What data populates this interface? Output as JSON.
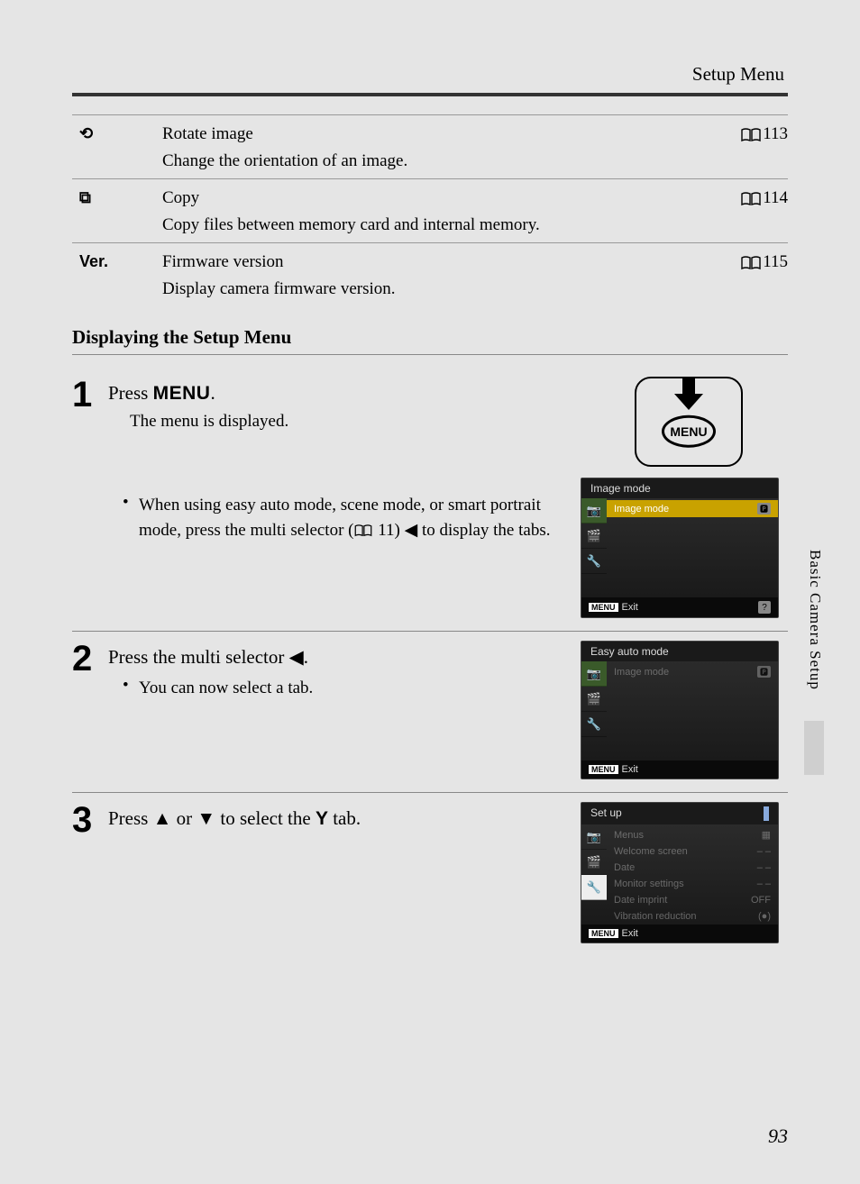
{
  "header": {
    "section": "Setup Menu"
  },
  "table": {
    "rows": [
      {
        "icon": "rotate",
        "title": "Rotate image",
        "ref": "113",
        "desc": "Change the orientation of an image."
      },
      {
        "icon": "copy",
        "title": "Copy",
        "ref": "114",
        "desc": "Copy files between memory card and internal memory."
      },
      {
        "icon": "ver",
        "icon_label": "Ver.",
        "title": "Firmware version",
        "ref": "115",
        "desc": "Display camera firmware version."
      }
    ]
  },
  "heading": "Displaying the Setup Menu",
  "steps": {
    "s1": {
      "num": "1",
      "title_pre": "Press ",
      "title_btn": "MENU",
      "title_post": ".",
      "note": "The menu is displayed.",
      "bullet_pre": "When using easy auto mode, scene mode, or smart portrait mode, press the multi selector (",
      "bullet_ref": "11",
      "bullet_post": ") ◀ to display the tabs.",
      "menu_label": "MENU",
      "lcd": {
        "title": "Image mode",
        "row_label": "Image mode",
        "exit": "Exit"
      }
    },
    "s2": {
      "num": "2",
      "title": "Press the multi selector ◀.",
      "bullet": "You can now select a tab.",
      "lcd": {
        "title": "Easy auto mode",
        "row_label": "Image mode",
        "exit": "Exit"
      }
    },
    "s3": {
      "num": "3",
      "title_pre": "Press ▲ or ▼ to select the ",
      "title_icon": "🔧",
      "title_post": " tab.",
      "lcd": {
        "title": "Set up",
        "rows": [
          {
            "label": "Menus",
            "val": "▦"
          },
          {
            "label": "Welcome screen",
            "val": "– –"
          },
          {
            "label": "Date",
            "val": "– –"
          },
          {
            "label": "Monitor settings",
            "val": "– –"
          },
          {
            "label": "Date imprint",
            "val": "OFF"
          },
          {
            "label": "Vibration reduction",
            "val": "(●)"
          }
        ],
        "exit": "Exit"
      }
    }
  },
  "sidetab": "Basic Camera Setup",
  "pagenum": "93"
}
